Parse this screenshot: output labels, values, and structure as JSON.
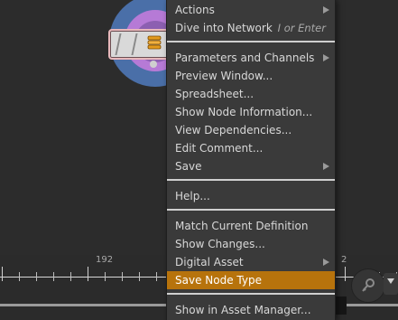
{
  "menu": {
    "items": [
      {
        "label": "Actions",
        "submenu": true
      },
      {
        "label": "Dive into Network",
        "shortcut": "I or Enter"
      },
      {
        "label": "Parameters and Channels",
        "submenu": true
      },
      {
        "label": "Preview Window..."
      },
      {
        "label": "Spreadsheet..."
      },
      {
        "label": "Show Node Information..."
      },
      {
        "label": "View Dependencies..."
      },
      {
        "label": "Edit Comment..."
      },
      {
        "label": "Save",
        "submenu": true
      },
      {
        "label": "Help..."
      },
      {
        "label": "Match Current Definition"
      },
      {
        "label": "Show Changes..."
      },
      {
        "label": "Digital Asset",
        "submenu": true
      },
      {
        "label": "Save Node Type",
        "highlighted": true
      },
      {
        "label": "Show in Asset Manager..."
      }
    ]
  },
  "timeline": {
    "frame_labels": [
      "192",
      "2"
    ]
  },
  "node": {
    "icon": "stack-icon",
    "colors": {
      "outer_ring": "#4a6fa8",
      "inner_ring": "#b67ad6",
      "box": "#d9d9d9"
    }
  },
  "colors": {
    "highlight": "#b7730c",
    "menu_bg": "#3a3a3a",
    "background": "#2c2c2c"
  }
}
